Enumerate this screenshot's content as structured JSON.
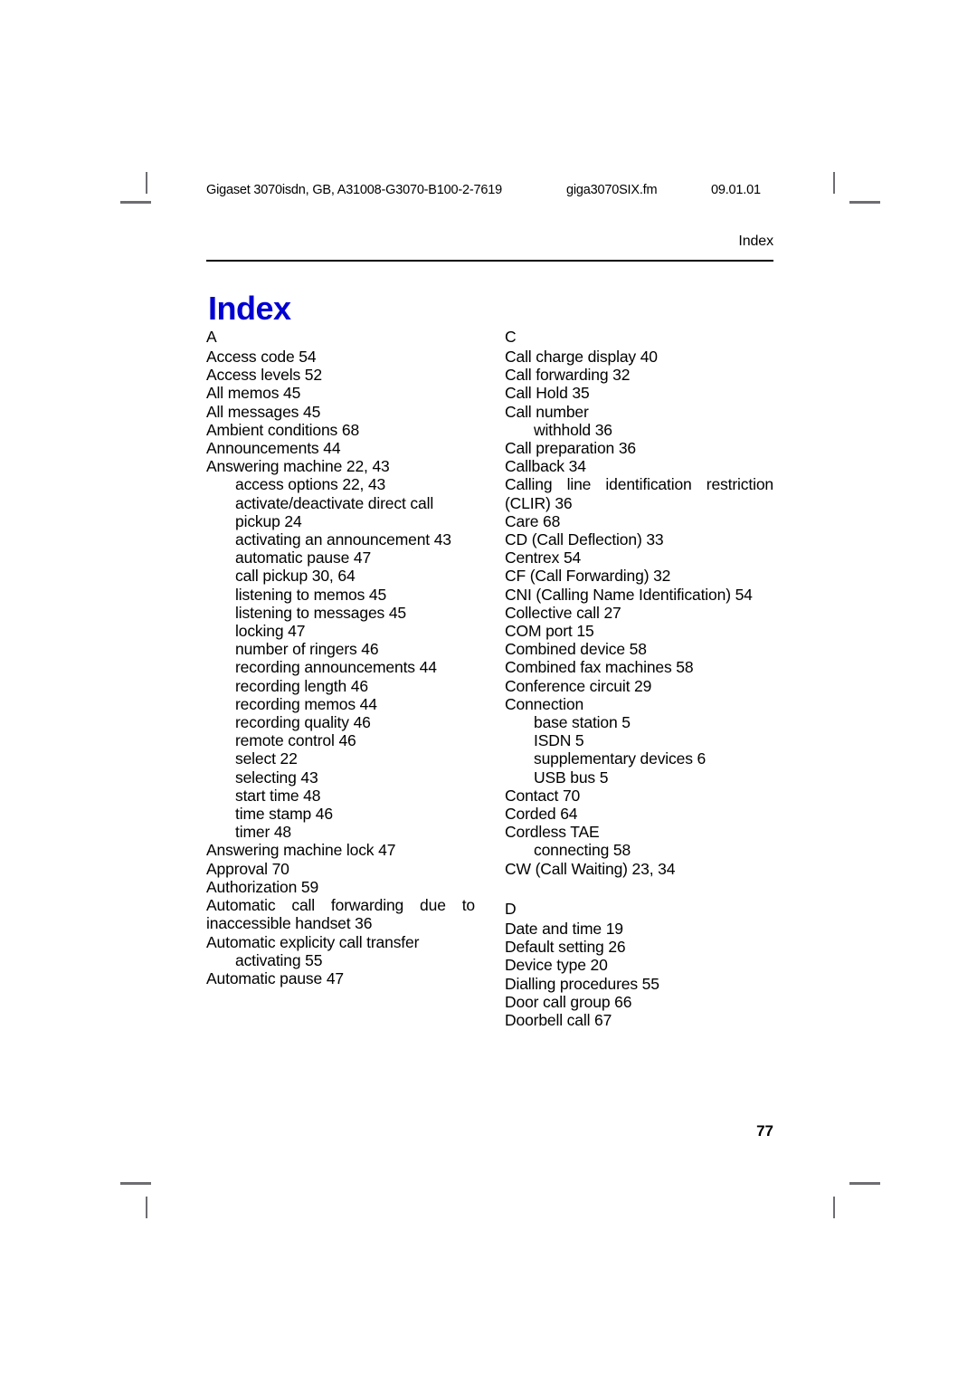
{
  "page": {
    "header": {
      "document_id": "Gigaset 3070isdn, GB, A31008-G3070-B100-2-7619",
      "file_name": "giga3070SIX.fm",
      "date": "09.01.01"
    },
    "running_head": "Index",
    "chapter_title": "Index",
    "page_number": "77",
    "title_color": "#0000d2"
  },
  "columns": [
    {
      "id": "left",
      "sections": [
        {
          "letter": "A",
          "entries": [
            {
              "text": "Access code 54",
              "level": 0,
              "justified": false
            },
            {
              "text": "Access levels 52",
              "level": 0,
              "justified": false
            },
            {
              "text": "All memos 45",
              "level": 0,
              "justified": false
            },
            {
              "text": "All messages 45",
              "level": 0,
              "justified": false
            },
            {
              "text": "Ambient conditions 68",
              "level": 0,
              "justified": false
            },
            {
              "text": "Announcements 44",
              "level": 0,
              "justified": false
            },
            {
              "text": "Answering machine 22, 43",
              "level": 0,
              "justified": false
            },
            {
              "text": "access options 22, 43",
              "level": 1,
              "justified": false
            },
            {
              "text": "activate/deactivate direct call pickup 24",
              "level": 1,
              "justified": false
            },
            {
              "text": "activating an announcement 43",
              "level": 1,
              "justified": false
            },
            {
              "text": "automatic pause 47",
              "level": 1,
              "justified": false
            },
            {
              "text": "call pickup 30, 64",
              "level": 1,
              "justified": false
            },
            {
              "text": "listening to memos 45",
              "level": 1,
              "justified": false
            },
            {
              "text": "listening to messages 45",
              "level": 1,
              "justified": false
            },
            {
              "text": "locking 47",
              "level": 1,
              "justified": false
            },
            {
              "text": "number of ringers 46",
              "level": 1,
              "justified": false
            },
            {
              "text": "recording announcements 44",
              "level": 1,
              "justified": false
            },
            {
              "text": "recording length 46",
              "level": 1,
              "justified": false
            },
            {
              "text": "recording memos 44",
              "level": 1,
              "justified": false
            },
            {
              "text": "recording quality 46",
              "level": 1,
              "justified": false
            },
            {
              "text": "remote control 46",
              "level": 1,
              "justified": false
            },
            {
              "text": "select 22",
              "level": 1,
              "justified": false
            },
            {
              "text": "selecting 43",
              "level": 1,
              "justified": false
            },
            {
              "text": "start time 48",
              "level": 1,
              "justified": false
            },
            {
              "text": "time stamp 46",
              "level": 1,
              "justified": false
            },
            {
              "text": "timer 48",
              "level": 1,
              "justified": false
            },
            {
              "text": "Answering machine lock 47",
              "level": 0,
              "justified": false
            },
            {
              "text": "Approval 70",
              "level": 0,
              "justified": false
            },
            {
              "text": "Authorization 59",
              "level": 0,
              "justified": false
            },
            {
              "text": "Automatic call forwarding due to inaccessible handset 36",
              "level": 0,
              "justified": true
            },
            {
              "text": "Automatic explicity call transfer",
              "level": 0,
              "justified": false
            },
            {
              "text": "activating 55",
              "level": 1,
              "justified": false
            },
            {
              "text": "Automatic pause 47",
              "level": 0,
              "justified": false
            }
          ]
        }
      ]
    },
    {
      "id": "right",
      "sections": [
        {
          "letter": "C",
          "entries": [
            {
              "text": "Call charge display 40",
              "level": 0,
              "justified": false
            },
            {
              "text": "Call forwarding 32",
              "level": 0,
              "justified": false
            },
            {
              "text": "Call Hold 35",
              "level": 0,
              "justified": false
            },
            {
              "text": "Call number",
              "level": 0,
              "justified": false
            },
            {
              "text": "withhold 36",
              "level": 1,
              "justified": false
            },
            {
              "text": "Call preparation 36",
              "level": 0,
              "justified": false
            },
            {
              "text": "Callback 34",
              "level": 0,
              "justified": false
            },
            {
              "text": "Calling line identification restriction (CLIR) 36",
              "level": 0,
              "justified": true
            },
            {
              "text": "Care 68",
              "level": 0,
              "justified": false
            },
            {
              "text": "CD (Call Deflection) 33",
              "level": 0,
              "justified": false
            },
            {
              "text": "Centrex 54",
              "level": 0,
              "justified": false
            },
            {
              "text": "CF (Call Forwarding) 32",
              "level": 0,
              "justified": false
            },
            {
              "text": "CNI (Calling Name Identification) 54",
              "level": 0,
              "justified": false
            },
            {
              "text": "Collective call 27",
              "level": 0,
              "justified": false
            },
            {
              "text": "COM port 15",
              "level": 0,
              "justified": false
            },
            {
              "text": "Combined device 58",
              "level": 0,
              "justified": false
            },
            {
              "text": "Combined fax machines 58",
              "level": 0,
              "justified": false
            },
            {
              "text": "Conference circuit 29",
              "level": 0,
              "justified": false
            },
            {
              "text": "Connection",
              "level": 0,
              "justified": false
            },
            {
              "text": "base station 5",
              "level": 1,
              "justified": false
            },
            {
              "text": "ISDN 5",
              "level": 1,
              "justified": false
            },
            {
              "text": "supplementary devices 6",
              "level": 1,
              "justified": false
            },
            {
              "text": "USB bus 5",
              "level": 1,
              "justified": false
            },
            {
              "text": "Contact 70",
              "level": 0,
              "justified": false
            },
            {
              "text": "Corded 64",
              "level": 0,
              "justified": false
            },
            {
              "text": "Cordless TAE",
              "level": 0,
              "justified": false
            },
            {
              "text": "connecting 58",
              "level": 1,
              "justified": false
            },
            {
              "text": "CW (Call Waiting) 23, 34",
              "level": 0,
              "justified": false
            }
          ]
        },
        {
          "letter": "D",
          "spaced": true,
          "entries": [
            {
              "text": "Date and time 19",
              "level": 0,
              "justified": false
            },
            {
              "text": "Default setting 26",
              "level": 0,
              "justified": false
            },
            {
              "text": "Device type 20",
              "level": 0,
              "justified": false
            },
            {
              "text": "Dialling procedures 55",
              "level": 0,
              "justified": false
            },
            {
              "text": "Door call group 66",
              "level": 0,
              "justified": false
            },
            {
              "text": "Doorbell call 67",
              "level": 0,
              "justified": false
            }
          ]
        }
      ]
    }
  ]
}
